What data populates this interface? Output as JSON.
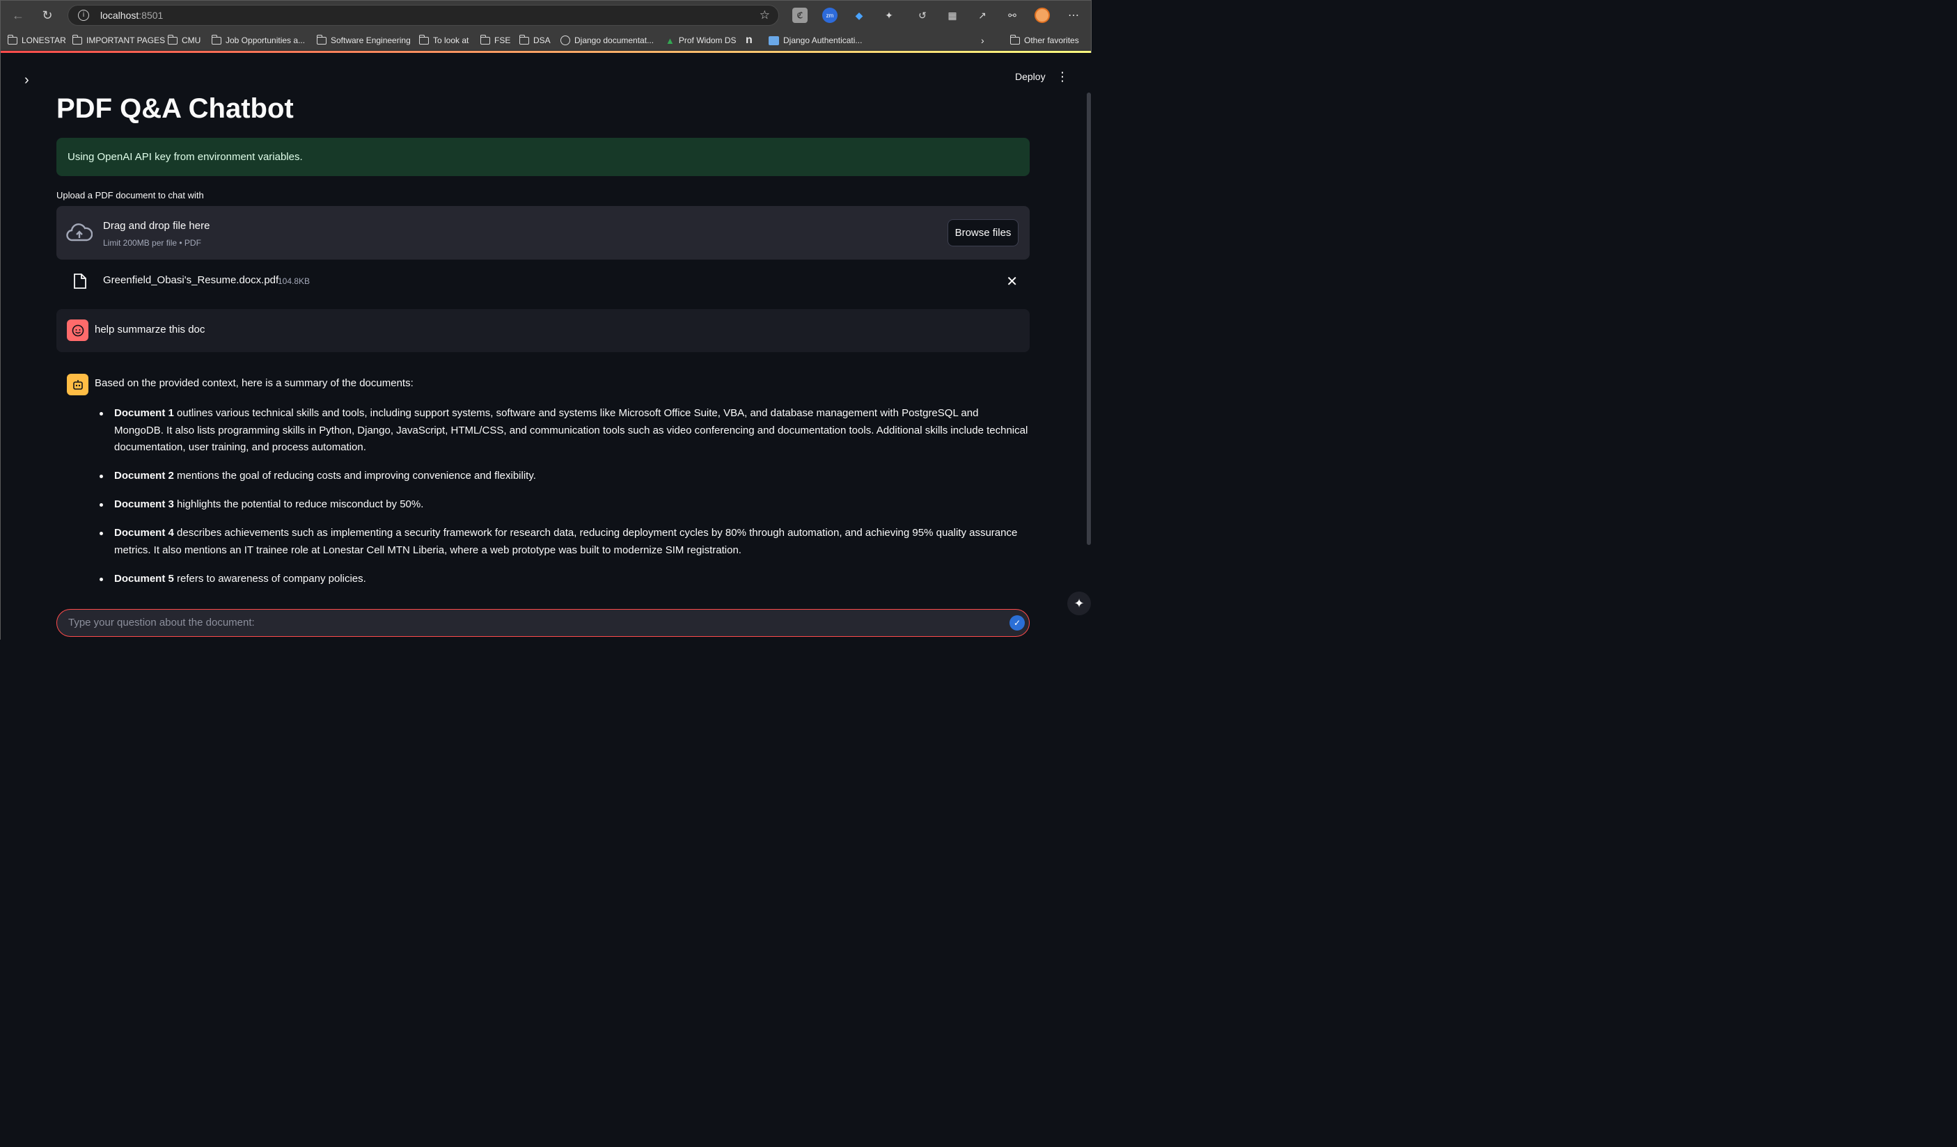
{
  "browser": {
    "url_host": "localhost",
    "url_port": ":8501",
    "bookmarks": [
      "LONESTAR",
      "IMPORTANT PAGES",
      "CMU",
      "Job Opportunities a...",
      "Software Engineering",
      "To look at",
      "FSE",
      "DSA",
      "Django documentat...",
      "Prof Widom DS",
      "Django Authenticati...",
      "Other favorites"
    ]
  },
  "app": {
    "deploy_label": "Deploy",
    "title": "PDF Q&A Chatbot",
    "success_message": "Using OpenAI API key from environment variables.",
    "upload_label": "Upload a PDF document to chat with",
    "dropzone_title": "Drag and drop file here",
    "dropzone_limit": "Limit 200MB per file • PDF",
    "browse_label": "Browse files",
    "uploaded_file": {
      "name": "Greenfield_Obasi's_Resume.docx.pdf",
      "size": "104.8KB"
    },
    "user_message": "help summarze this doc",
    "assistant_intro": "Based on the provided context, here is a summary of the documents:",
    "summary": [
      {
        "doc": "Document 1",
        "text": " outlines various technical skills and tools, including support systems, software and systems like Microsoft Office Suite, VBA, and database management with PostgreSQL and MongoDB. It also lists programming skills in Python, Django, JavaScript, HTML/CSS, and communication tools such as video conferencing and documentation tools. Additional skills include technical documentation, user training, and process automation."
      },
      {
        "doc": "Document 2",
        "text": " mentions the goal of reducing costs and improving convenience and flexibility."
      },
      {
        "doc": "Document 3",
        "text": " highlights the potential to reduce misconduct by 50%."
      },
      {
        "doc": "Document 4",
        "text": " describes achievements such as implementing a security framework for research data, reducing deployment cycles by 80% through automation, and achieving 95% quality assurance metrics. It also mentions an IT trainee role at Lonestar Cell MTN Liberia, where a web prototype was built to modernize SIM registration."
      },
      {
        "doc": "Document 5",
        "text": " refers to awareness of company policies."
      }
    ],
    "chat_placeholder": "Type your question about the document:"
  },
  "colors": {
    "background": "#0e1117",
    "success_bg": "#173928",
    "accent": "#ff4b4b",
    "user_avatar": "#ff6b6b",
    "bot_avatar": "#ffbd45"
  }
}
